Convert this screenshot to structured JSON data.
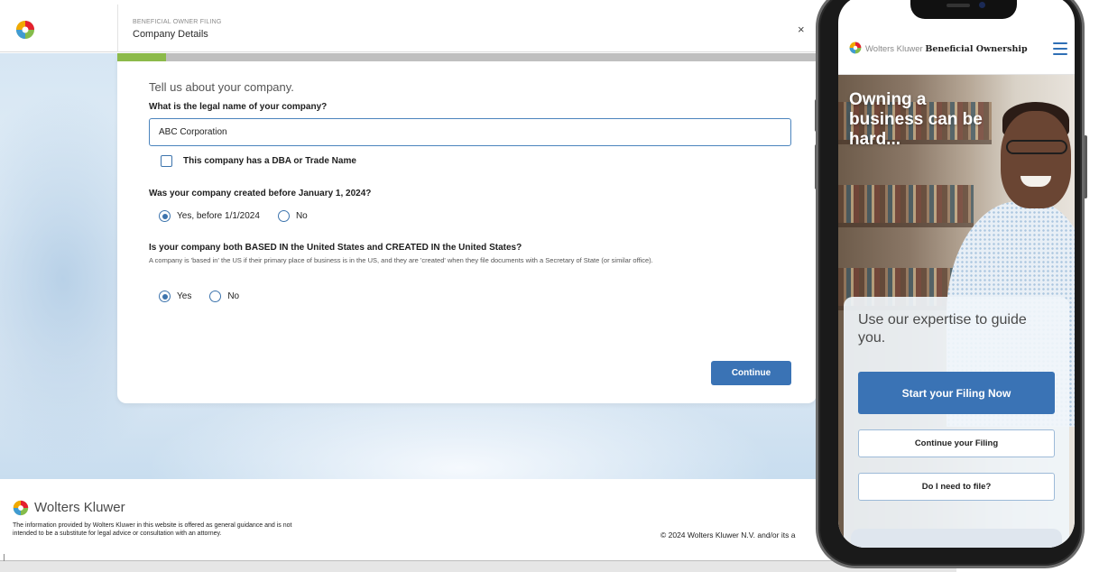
{
  "header": {
    "eyebrow": "BENEFICIAL OWNER FILING",
    "title": "Company Details",
    "close_label": "×"
  },
  "progress": {
    "fraction": 0.07
  },
  "form": {
    "intro": "Tell us about your company.",
    "name_question": "What is the legal name of your company?",
    "name_value": "ABC Corporation",
    "dba_label": "This company has a DBA or Trade Name",
    "dba_checked": false,
    "created_question": "Was your company created before January 1, 2024?",
    "created_options": [
      {
        "label": "Yes, before 1/1/2024",
        "checked": true
      },
      {
        "label": "No",
        "checked": false
      }
    ],
    "us_question": "Is your company both BASED IN the United States and CREATED IN the United States?",
    "us_hint": "A company is 'based in' the US if their primary place of business is in the US, and they are 'created' when they file documents with a Secretary of State (or similar office).",
    "us_options": [
      {
        "label": "Yes",
        "checked": true
      },
      {
        "label": "No",
        "checked": false
      }
    ],
    "continue_label": "Continue"
  },
  "footer": {
    "brand": "Wolters Kluwer",
    "disclaimer": "The information provided by Wolters Kluwer in this website is offered as general guidance and is not intended to be a substitute for legal advice or consultation with an attorney.",
    "copyright": "© 2024 Wolters Kluwer N.V. and/or its a"
  },
  "phone": {
    "brand_light": "Wolters Kluwer",
    "brand_bold": "Beneficial Ownership",
    "menu_icon": "hamburger-menu-icon",
    "hero_text": "Owning a business can be hard...",
    "tagline": "Use our expertise to guide you.",
    "primary_button": "Start your Filing Now",
    "continue_button": "Continue your Filing",
    "need_button": "Do I need to file?"
  },
  "colors": {
    "accent": "#3a73b5",
    "progress": "#8cba4a",
    "radio": "#3d74ad"
  }
}
